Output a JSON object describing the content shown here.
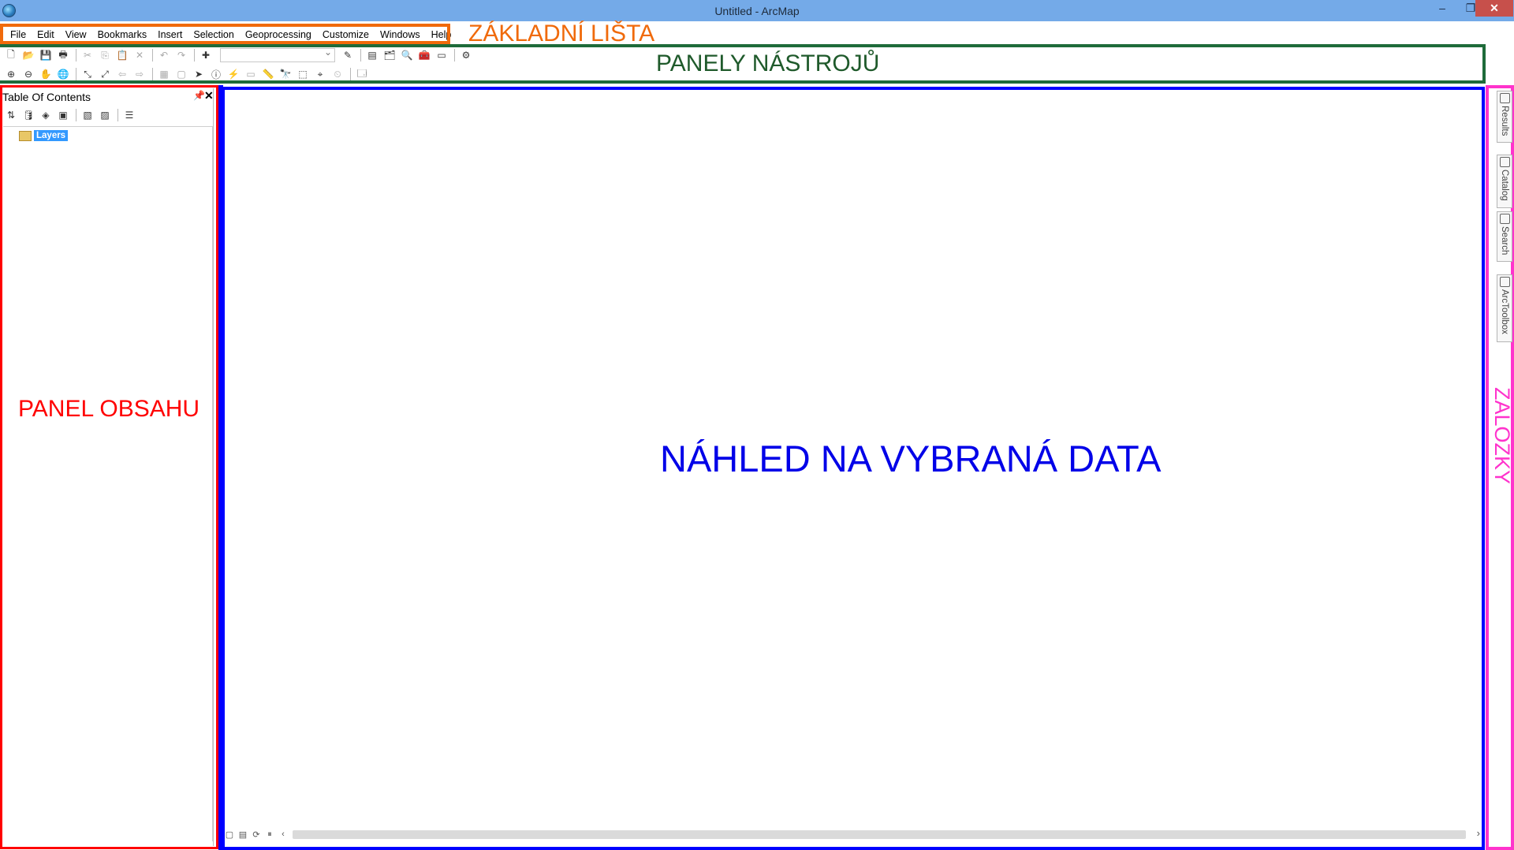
{
  "window": {
    "title": "Untitled - ArcMap",
    "minimize_glyph": "‒",
    "restore_glyph": "❐",
    "close_glyph": "✕"
  },
  "menu": {
    "items": [
      "File",
      "Edit",
      "View",
      "Bookmarks",
      "Insert",
      "Selection",
      "Geoprocessing",
      "Customize",
      "Windows",
      "Help"
    ]
  },
  "toc": {
    "title": "Table Of Contents",
    "pin_glyph": "📌",
    "close_glyph": "✕",
    "layers_label": "Layers"
  },
  "dock_tabs": [
    {
      "label": "Results",
      "icon": "results-icon"
    },
    {
      "label": "Catalog",
      "icon": "catalog-icon"
    },
    {
      "label": "Search",
      "icon": "search-icon"
    },
    {
      "label": "ArcToolbox",
      "icon": "arctoolbox-icon"
    }
  ],
  "annotations": {
    "menu_bar": "ZÁKLADNÍ LIŠTA",
    "toolbars": "PANELY NÁSTROJŮ",
    "contents_panel": "PANEL OBSAHU",
    "data_view": "NÁHLED NA VYBRANÁ DATA",
    "tabs": "ZÁLOŽKY"
  },
  "colors": {
    "menu_frame": "#f06a0b",
    "toolbar_frame": "#1e6b3a",
    "toc_frame": "#ff0000",
    "map_frame": "#0000ff",
    "tabs_frame": "#ff33cc",
    "titlebar": "#74aae8",
    "selection": "#3399ff"
  }
}
